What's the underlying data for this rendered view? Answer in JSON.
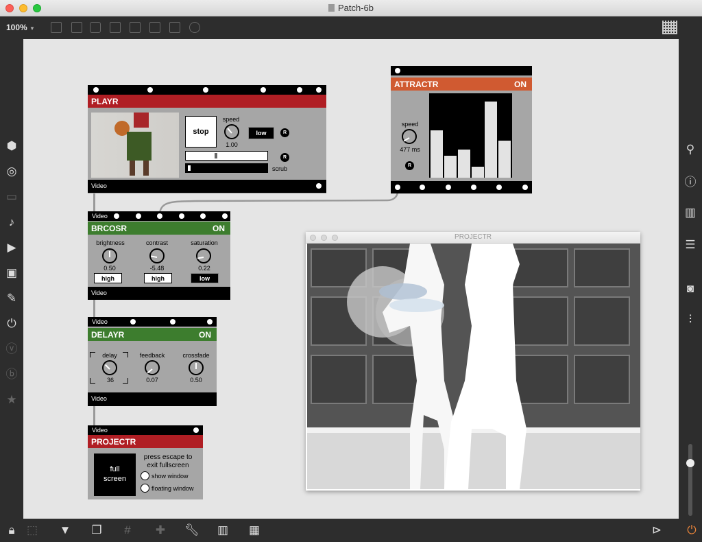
{
  "window": {
    "title": "Patch-6b"
  },
  "toolbar": {
    "zoom": "100%"
  },
  "modules": {
    "playr": {
      "header": "PLAYR",
      "stop_label": "stop",
      "speed_label": "speed",
      "speed_value": "1.00",
      "quality_label": "low",
      "r_label": "R",
      "r2_label": "R",
      "scrub_label": "scrub",
      "footer": "Video"
    },
    "attractr": {
      "header": "ATTRACTR",
      "state": "ON",
      "speed_label": "speed",
      "speed_value": "477 ms",
      "r_label": "R",
      "bars": [
        0.56,
        0.26,
        0.33,
        0.13,
        0.9,
        0.44
      ]
    },
    "brcosr": {
      "top_label": "Video",
      "header": "BRCOSR",
      "state": "ON",
      "brightness_label": "brightness",
      "brightness_value": "0.50",
      "brightness_mode": "high",
      "contrast_label": "contrast",
      "contrast_value": "-5.48",
      "contrast_mode": "high",
      "saturation_label": "saturation",
      "saturation_value": "0.22",
      "saturation_mode": "low",
      "footer": "Video"
    },
    "delayr": {
      "top_label": "Video",
      "header": "DELAYR",
      "state": "ON",
      "delay_label": "delay",
      "delay_value": "36",
      "feedback_label": "feedback",
      "feedback_value": "0.07",
      "crossfade_label": "crossfade",
      "crossfade_value": "0.50",
      "footer": "Video"
    },
    "projectr": {
      "top_label": "Video",
      "header": "PROJECTR",
      "fullscreen_line1": "full",
      "fullscreen_line2": "screen",
      "hint_line1": "press escape to",
      "hint_line2": "exit fullscreen",
      "show_window_label": "show window",
      "floating_window_label": "floating window"
    }
  },
  "projector_window": {
    "title": "PROJECTR"
  },
  "colors": {
    "red": "#b01e24",
    "green": "#3d7d2e",
    "orange": "#d05a31"
  }
}
